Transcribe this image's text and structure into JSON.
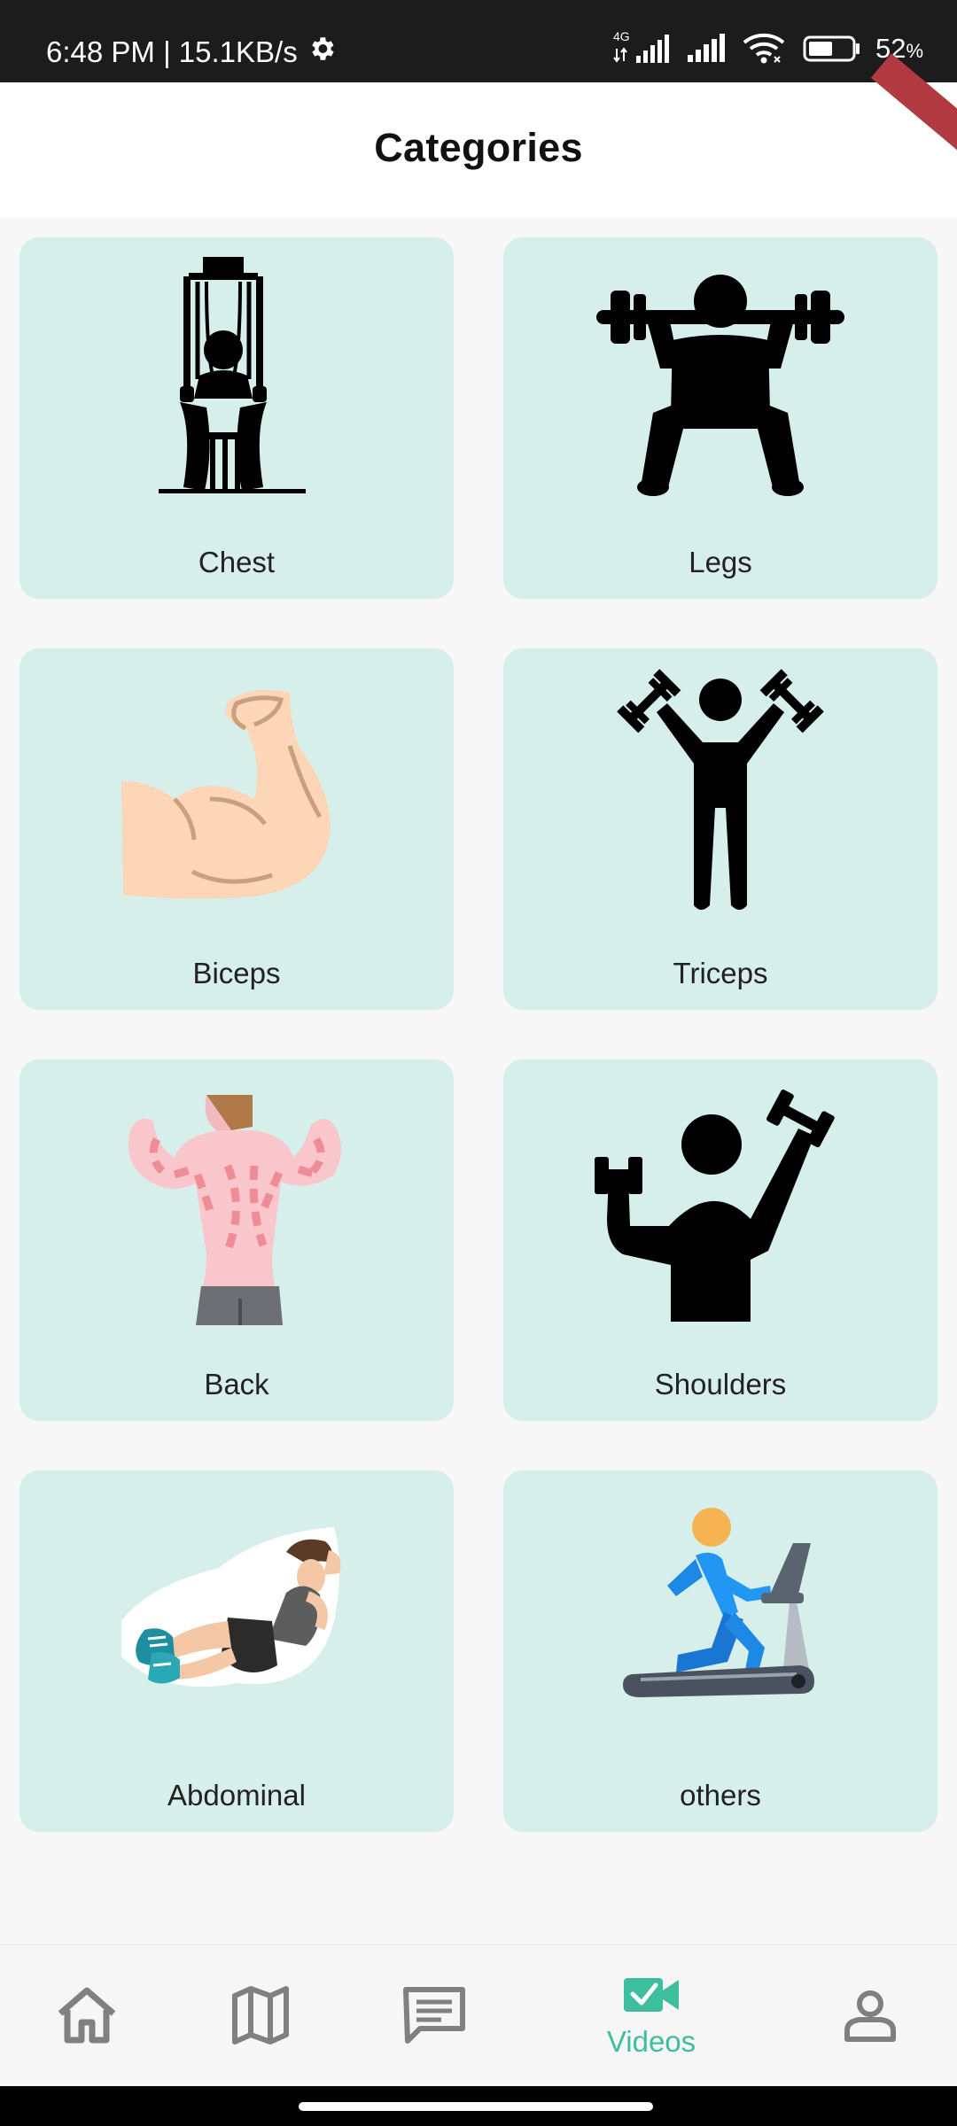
{
  "status_bar": {
    "time": "6:48 PM | 15.1KB/s",
    "network_label": "4G",
    "battery": "52",
    "battery_unit": "%"
  },
  "header": {
    "title": "Categories"
  },
  "categories": [
    {
      "label": "Chest",
      "icon": "chest-press-machine-icon"
    },
    {
      "label": "Legs",
      "icon": "squat-barbell-icon"
    },
    {
      "label": "Biceps",
      "icon": "flexed-biceps-icon"
    },
    {
      "label": "Triceps",
      "icon": "dumbbells-overhead-icon"
    },
    {
      "label": "Back",
      "icon": "back-muscles-icon"
    },
    {
      "label": "Shoulders",
      "icon": "shoulder-press-icon"
    },
    {
      "label": "Abdominal",
      "icon": "sit-up-icon"
    },
    {
      "label": "others",
      "icon": "treadmill-runner-icon"
    }
  ],
  "bottom_nav": {
    "items": [
      {
        "icon": "home-icon",
        "active": false
      },
      {
        "icon": "map-icon",
        "active": false
      },
      {
        "icon": "chat-icon",
        "active": false
      },
      {
        "icon": "video-icon",
        "label": "Videos",
        "active": true
      },
      {
        "icon": "profile-icon",
        "active": false
      }
    ]
  },
  "colors": {
    "card_bg": "#d6efea",
    "accent": "#3dbf9f",
    "nav_inactive": "#808080"
  }
}
